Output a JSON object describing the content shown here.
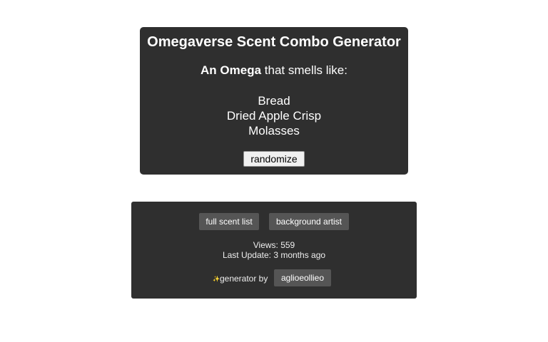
{
  "generator": {
    "title": "Omegaverse Scent Combo Generator",
    "subject_bold": "An Omega",
    "subject_rest": " that smells like:",
    "scents": [
      "Bread",
      "Dried Apple Crisp",
      "Molasses"
    ],
    "randomize_label": "randomize"
  },
  "footer": {
    "full_scent_list_label": "full scent list",
    "background_artist_label": "background artist",
    "views_text": "Views: 559",
    "last_update_text": "Last Update: 3 months ago",
    "sparkle_glyph": "✨",
    "generator_by_text": "generator by",
    "author_label": "aglioeollieo"
  },
  "colors": {
    "card_background": "#2f2f2f",
    "pill_background": "#555555",
    "text": "#ffffff"
  }
}
